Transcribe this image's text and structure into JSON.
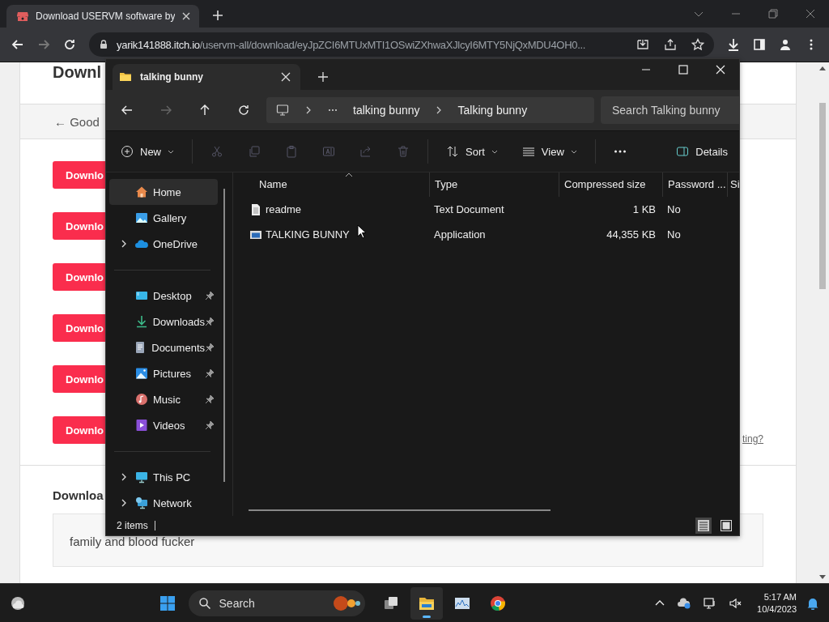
{
  "browser": {
    "tab_title": "Download USERVM software by",
    "url_host": "yarik141888.itch.io",
    "url_path": "/uservm-all/download/eyJpZCI6MTUxMTI1OSwiZXhwaXJlcyI6MTY5NjQxMDU4OH0..."
  },
  "page": {
    "heading": "Downl",
    "back_link": "← Good",
    "download_buttons": [
      "Downlo",
      "Downlo",
      "Downlo",
      "Downlo",
      "Downlo",
      "Downlo"
    ],
    "support_link": "ting?",
    "section_heading": "Downloa",
    "comment": "family and blood fucker"
  },
  "explorer": {
    "tab_title": "talking bunny",
    "breadcrumb": [
      "talking bunny",
      "Talking bunny"
    ],
    "search": {
      "placeholder": "Search Talking bunny"
    },
    "toolbar": {
      "new": "New",
      "sort": "Sort",
      "view": "View",
      "details": "Details"
    },
    "nav_groups": [
      {
        "items": [
          {
            "label": "Home",
            "kind": "home",
            "selected": true,
            "pinned": false,
            "expandable": false
          },
          {
            "label": "Gallery",
            "kind": "gallery",
            "selected": false,
            "pinned": false,
            "expandable": false
          },
          {
            "label": "OneDrive",
            "kind": "cloud",
            "selected": false,
            "pinned": false,
            "expandable": true
          }
        ]
      },
      {
        "items": [
          {
            "label": "Desktop",
            "kind": "desktop",
            "selected": false,
            "pinned": true,
            "expandable": false
          },
          {
            "label": "Downloads",
            "kind": "downloads",
            "selected": false,
            "pinned": true,
            "expandable": false
          },
          {
            "label": "Documents",
            "kind": "documents",
            "selected": false,
            "pinned": true,
            "expandable": false
          },
          {
            "label": "Pictures",
            "kind": "pictures",
            "selected": false,
            "pinned": true,
            "expandable": false
          },
          {
            "label": "Music",
            "kind": "music",
            "selected": false,
            "pinned": true,
            "expandable": false
          },
          {
            "label": "Videos",
            "kind": "videos",
            "selected": false,
            "pinned": true,
            "expandable": false
          }
        ]
      },
      {
        "items": [
          {
            "label": "This PC",
            "kind": "pc",
            "selected": false,
            "pinned": false,
            "expandable": true
          },
          {
            "label": "Network",
            "kind": "network",
            "selected": false,
            "pinned": false,
            "expandable": true
          }
        ]
      }
    ],
    "columns": [
      "Name",
      "Type",
      "Compressed size",
      "Password ...",
      "Si"
    ],
    "files": [
      {
        "name": "readme",
        "kind": "text",
        "type": "Text Document",
        "size": "1 KB",
        "password": "No"
      },
      {
        "name": "TALKING BUNNY",
        "kind": "app",
        "type": "Application",
        "size": "44,355 KB",
        "password": "No"
      }
    ],
    "status": "2 items"
  },
  "taskbar": {
    "search": "Search",
    "time": "5:17 AM",
    "date": "10/4/2023",
    "apps": [
      {
        "kind": "taskview",
        "active": false
      },
      {
        "kind": "explorer",
        "active": true
      },
      {
        "kind": "monitor",
        "active": false
      },
      {
        "kind": "chrome",
        "active": false
      }
    ]
  }
}
